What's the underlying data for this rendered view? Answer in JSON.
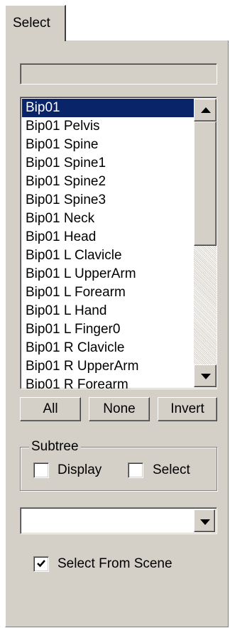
{
  "tab": {
    "label": "Select"
  },
  "search": {
    "value": ""
  },
  "list": {
    "items": [
      "Bip01",
      "Bip01 Pelvis",
      "Bip01 Spine",
      "Bip01 Spine1",
      "Bip01 Spine2",
      "Bip01 Spine3",
      "Bip01 Neck",
      "Bip01 Head",
      "Bip01 L Clavicle",
      "Bip01 L UpperArm",
      "Bip01 L Forearm",
      "Bip01 L Hand",
      "Bip01 L Finger0",
      "Bip01 R Clavicle",
      "Bip01 R UpperArm",
      "Bip01 R Forearm"
    ],
    "selected_index": 0
  },
  "buttons": {
    "all": "All",
    "none": "None",
    "invert": "Invert"
  },
  "subtree": {
    "label": "Subtree",
    "display_label": "Display",
    "display_checked": false,
    "select_label": "Select",
    "select_checked": false
  },
  "dropdown": {
    "value": ""
  },
  "select_from_scene": {
    "label": "Select From Scene",
    "checked": true
  },
  "colors": {
    "panel": "#d4d0c8",
    "selection": "#0a246a",
    "selection_text": "#ffffff"
  }
}
